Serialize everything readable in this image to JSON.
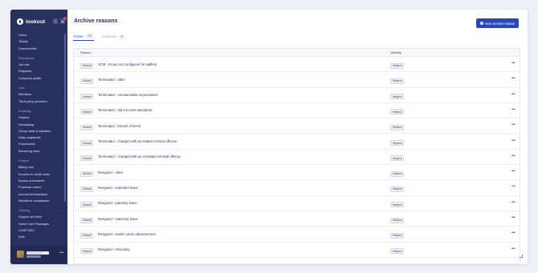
{
  "app": {
    "name": "lookout"
  },
  "sidebar": {
    "top": [
      "Home",
      "Tickets",
      "Communities"
    ],
    "sections": [
      {
        "title": "Recruitment",
        "items": [
          "Job ads",
          "Requests",
          "Company profile"
        ]
      },
      {
        "title": "Care",
        "items": [
          "Members",
          "Third party providers"
        ]
      },
      {
        "title": "Rostering",
        "items": [
          "Helpers",
          "Scheduling",
          "Group visits & activities",
          "Daily snapshots",
          "Punchcards",
          "Recurring roles"
        ]
      },
      {
        "title": "Finance",
        "items": [
          "Billing runs",
          "Invoices & credit notes",
          "Invoice summaries",
          "Purchase orders",
          "Account transactions",
          "Workforce compliance"
        ]
      },
      {
        "title": "Claiming",
        "items": [
          "Support at Home",
          "Home Care Packages",
          "CHSP DEX",
          "DVA"
        ]
      }
    ],
    "user_more": "•••"
  },
  "page": {
    "title": "Archive reasons",
    "new_button_label": "New archive reason",
    "new_button_icon": "plus-icon"
  },
  "tabs": [
    {
      "label": "Active",
      "count": "26",
      "active": true
    },
    {
      "label": "Archived",
      "count": "0",
      "active": false
    }
  ],
  "table": {
    "columns": [
      "Reason",
      "Visibility"
    ],
    "rows": [
      {
        "badge": "Default",
        "reason": "SCM - Group not configured for staffers",
        "visibility": "Helpers"
      },
      {
        "badge": "Default",
        "reason": "Terminated - other",
        "visibility": "Helpers"
      },
      {
        "badge": "Default",
        "reason": "Terminated - unreasonable expectations",
        "visibility": "Helpers"
      },
      {
        "badge": "Default",
        "reason": "Terminated - did not meet standards",
        "visibility": "Helpers"
      },
      {
        "badge": "Default",
        "reason": "Terminated - breach of terms",
        "visibility": "Helpers"
      },
      {
        "badge": "Default",
        "reason": "Terminated - charged with an related criminal offence",
        "visibility": "Helpers"
      },
      {
        "badge": "Default",
        "reason": "Terminated - charged with an unrelated criminal offence",
        "visibility": "Helpers"
      },
      {
        "badge": "Default",
        "reason": "Resigned - other",
        "visibility": "Helpers"
      },
      {
        "badge": "Default",
        "reason": "Resigned - extended leave",
        "visibility": "Helpers"
      },
      {
        "badge": "Default",
        "reason": "Resigned - paternity leave",
        "visibility": "Helpers"
      },
      {
        "badge": "Default",
        "reason": "Resigned - maternity leave",
        "visibility": "Helpers"
      },
      {
        "badge": "Default",
        "reason": "Resigned - wants career advancement",
        "visibility": "Helpers"
      },
      {
        "badge": "Default",
        "reason": "Resigned - relocating",
        "visibility": "Helpers"
      }
    ],
    "row_more": "•••"
  }
}
